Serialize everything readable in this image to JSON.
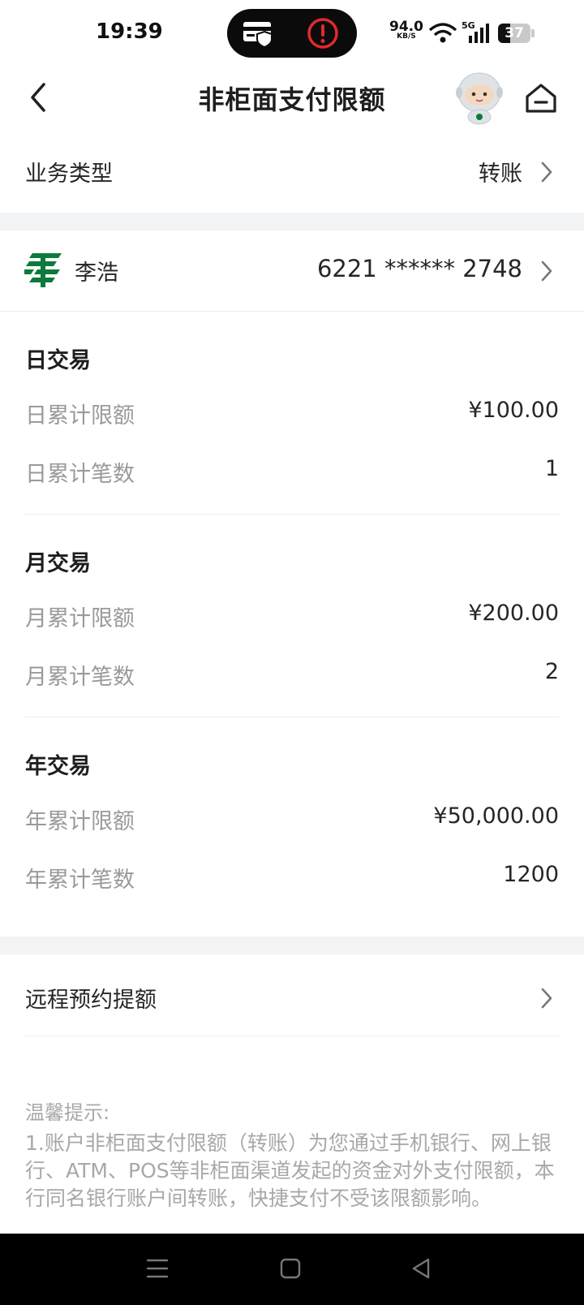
{
  "status_bar": {
    "time": "19:39",
    "net_speed": "94.0",
    "net_unit": "KB/S",
    "signal": "5G",
    "battery": "37"
  },
  "nav": {
    "title": "非柜面支付限额"
  },
  "business_type": {
    "label": "业务类型",
    "value": "转账"
  },
  "account": {
    "name": "李浩",
    "card_number": "6221 ****** 2748"
  },
  "sections": [
    {
      "title": "日交易",
      "items": [
        {
          "label": "日累计限额",
          "value": "¥100.00"
        },
        {
          "label": "日累计笔数",
          "value": "1"
        }
      ]
    },
    {
      "title": "月交易",
      "items": [
        {
          "label": "月累计限额",
          "value": "¥200.00"
        },
        {
          "label": "月累计笔数",
          "value": "2"
        }
      ]
    },
    {
      "title": "年交易",
      "items": [
        {
          "label": "年累计限额",
          "value": "¥50,000.00"
        },
        {
          "label": "年累计笔数",
          "value": "1200"
        }
      ]
    }
  ],
  "remote": {
    "label": "远程预约提额"
  },
  "tips": {
    "title": "温馨提示:",
    "body": "1.账户非柜面支付限额（转账）为您通过手机银行、网上银行、ATM、POS等非柜面渠道发起的资金对外支付限额，本行同名银行账户间转账，快捷支付不受该限额影响。"
  },
  "colors": {
    "brand_green": "#0c7a3c",
    "alert_red": "#e02a2a",
    "gap_gray": "#f2f3f5"
  },
  "icons": [
    "back-arrow-icon",
    "robot-mascot-icon",
    "home-icon",
    "chevron-right-icon",
    "postal-bank-logo-icon",
    "card-shield-icon",
    "alert-icon",
    "wifi-icon",
    "signal-icon",
    "battery-icon",
    "menu-icon",
    "square-icon",
    "triangle-back-icon"
  ]
}
